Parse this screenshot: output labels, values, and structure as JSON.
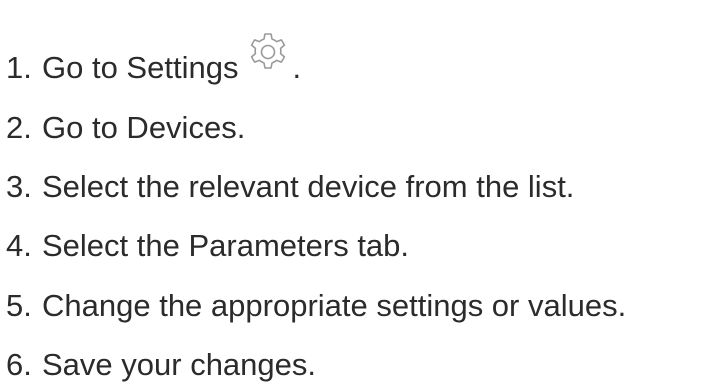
{
  "instructions": {
    "steps": [
      {
        "number": "1.",
        "text": "Go to Settings",
        "icon": "gear-icon",
        "suffix": "."
      },
      {
        "number": "2.",
        "text": "Go to Devices."
      },
      {
        "number": "3.",
        "text": "Select the relevant device from the list."
      },
      {
        "number": "4.",
        "text": "Select the Parameters tab."
      },
      {
        "number": "5.",
        "text": "Change the appropriate settings or values."
      },
      {
        "number": "6.",
        "text": "Save your changes."
      }
    ]
  },
  "colors": {
    "text": "#2b2b2b",
    "icon_stroke": "#9a9a9a",
    "background": "#ffffff"
  }
}
